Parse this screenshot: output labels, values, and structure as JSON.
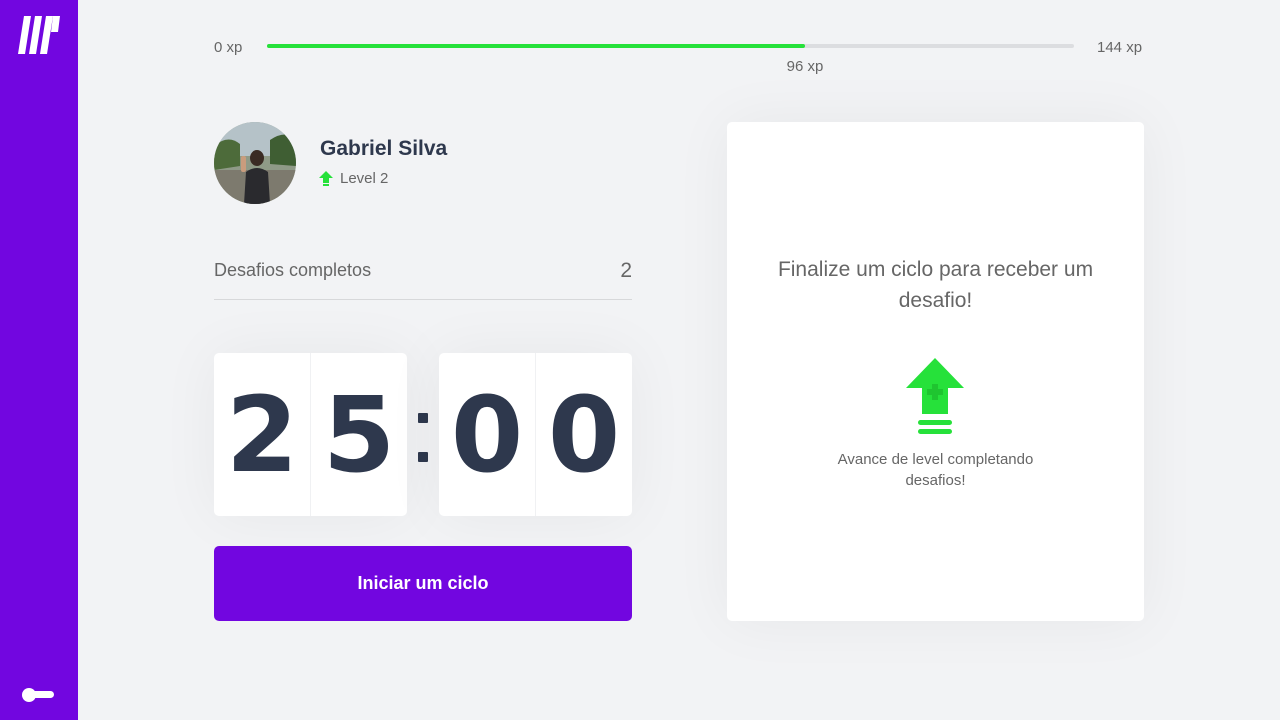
{
  "colors": {
    "accent": "#7206e0",
    "progress": "#26e13a",
    "background": "#f2f3f5",
    "title_text": "#2e384d",
    "body_text": "#666666"
  },
  "sidebar": {
    "logo_icon": "logo-icon",
    "bottom_icon": "toggle-icon"
  },
  "xp": {
    "min_label": "0 xp",
    "max_label": "144 xp",
    "current_label": "96 xp",
    "current": 96,
    "max": 144
  },
  "profile": {
    "name": "Gabriel Silva",
    "level_label": "Level 2",
    "level_icon": "level-up-icon"
  },
  "challenges": {
    "label": "Desafios completos",
    "count": "2"
  },
  "countdown": {
    "minutes": [
      "2",
      "5"
    ],
    "seconds": [
      "0",
      "0"
    ]
  },
  "start_button": {
    "label": "Iniciar um ciclo"
  },
  "challenge_box": {
    "title": "Finalize um ciclo para receber um desafio!",
    "icon": "level-up-icon",
    "description": "Avance de level completando desafios!"
  }
}
